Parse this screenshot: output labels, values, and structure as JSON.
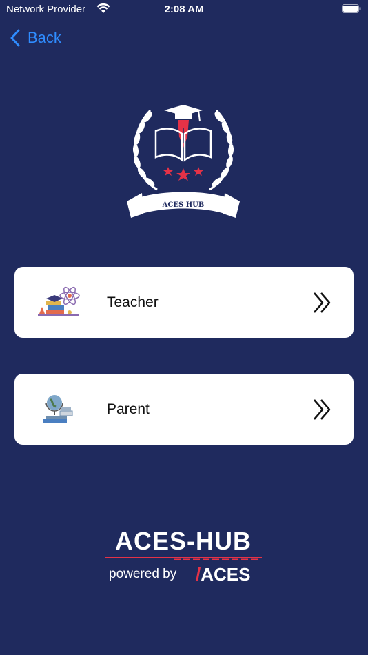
{
  "status_bar": {
    "carrier": "Network Provider",
    "time": "2:08 AM"
  },
  "nav": {
    "back_label": "Back"
  },
  "logo": {
    "text": "ACES HUB"
  },
  "roles": [
    {
      "label": "Teacher",
      "icon": "science-books-icon",
      "arrow_icon": "double-chevron-right-icon"
    },
    {
      "label": "Parent",
      "icon": "globe-books-icon",
      "arrow_icon": "double-chevron-right-icon"
    }
  ],
  "brand": {
    "title": "ACES-HUB",
    "powered_by": "powered by",
    "slash": "/",
    "aces": "ACES"
  },
  "colors": {
    "background": "#1f2a5e",
    "accent": "#2f8cff",
    "card": "#ffffff",
    "brand_red": "#e53247"
  }
}
